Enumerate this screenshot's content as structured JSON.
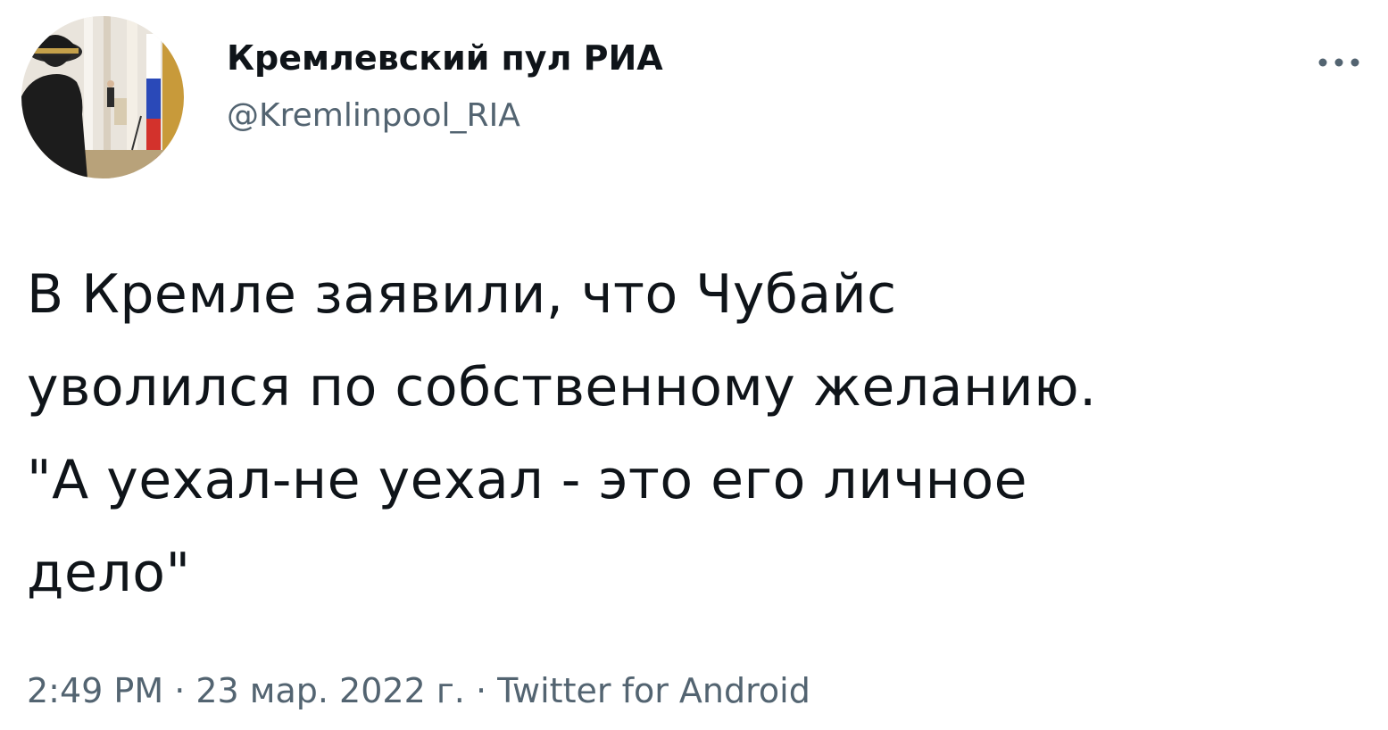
{
  "tweet": {
    "author": {
      "display_name": "Кремлевский пул РИА",
      "handle": "@Kremlinpool_RIA",
      "avatar": "avatar-photo"
    },
    "more_icon": "more-horizontal-icon",
    "text_lines": [
      "В Кремле заявили, что Чубайс",
      "уволился по собственному желанию.",
      "\"А уехал-не уехал - это его личное",
      "дело\""
    ],
    "meta": {
      "time": "2:49 PM",
      "separator": " · ",
      "date": "23 мар. 2022 г.",
      "source": "Twitter for Android"
    },
    "colors": {
      "text": "#0f1419",
      "secondary": "#536471",
      "background": "#ffffff"
    }
  }
}
